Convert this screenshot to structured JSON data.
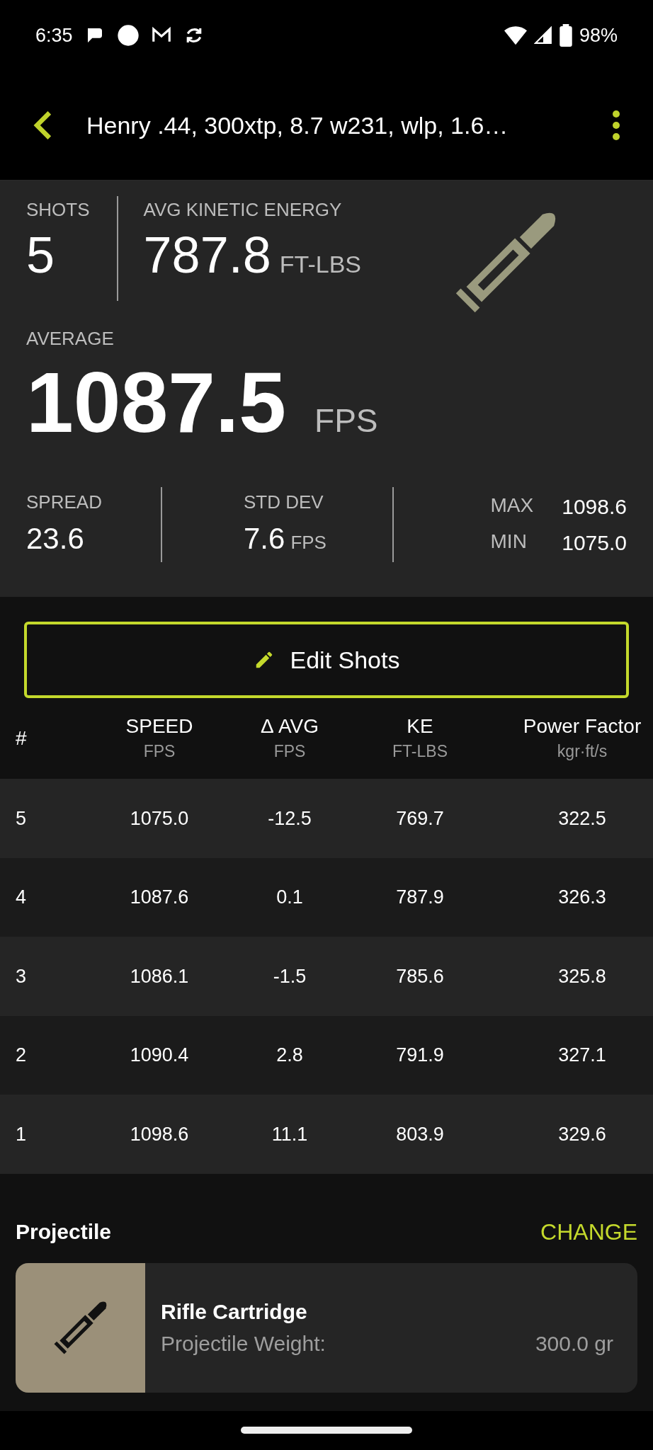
{
  "status_bar": {
    "time": "6:35",
    "battery": "98%"
  },
  "header": {
    "title": "Henry .44, 300xtp, 8.7 w231, wlp, 1.6…"
  },
  "summary": {
    "shots_label": "SHOTS",
    "shots": "5",
    "ke_label": "AVG KINETIC ENERGY",
    "ke": "787.8",
    "ke_unit": "FT-LBS",
    "average_label": "AVERAGE",
    "average": "1087.5",
    "average_unit": "FPS",
    "spread_label": "SPREAD",
    "spread": "23.6",
    "std_label": "STD DEV",
    "std": "7.6",
    "std_unit": "FPS",
    "max_label": "MAX",
    "max": "1098.6",
    "min_label": "MIN",
    "min": "1075.0"
  },
  "edit_button": "Edit Shots",
  "table": {
    "columns": [
      {
        "title": "#"
      },
      {
        "title": "SPEED",
        "unit": "FPS"
      },
      {
        "title": "Δ AVG",
        "unit": "FPS"
      },
      {
        "title": "KE",
        "unit": "FT-LBS"
      },
      {
        "title": "Power Factor",
        "unit": "kgr·ft/s"
      }
    ],
    "rows": [
      [
        "5",
        "1075.0",
        "-12.5",
        "769.7",
        "322.5"
      ],
      [
        "4",
        "1087.6",
        "0.1",
        "787.9",
        "326.3"
      ],
      [
        "3",
        "1086.1",
        "-1.5",
        "785.6",
        "325.8"
      ],
      [
        "2",
        "1090.4",
        "2.8",
        "791.9",
        "327.1"
      ],
      [
        "1",
        "1098.6",
        "11.1",
        "803.9",
        "329.6"
      ]
    ]
  },
  "projectile": {
    "title": "Projectile",
    "action": "CHANGE",
    "name": "Rifle Cartridge",
    "weight_label": "Projectile Weight:",
    "weight": "300.0 gr"
  }
}
